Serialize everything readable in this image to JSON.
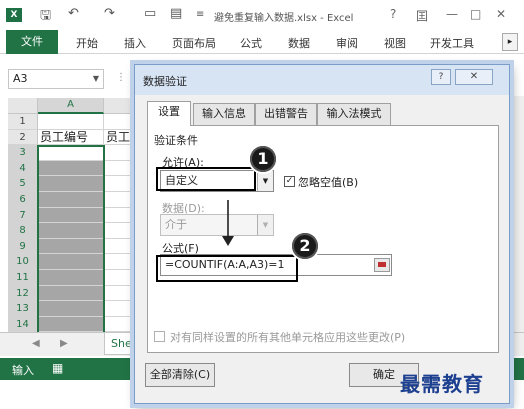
{
  "excel": {
    "logo": "X",
    "quick_access": {
      "save_icon": "save-icon",
      "undo_icon": "undo-icon",
      "redo_icon": "redo-icon"
    },
    "title_prefix": "≡",
    "title": "避免重复输入数据.xlsx - Excel",
    "window_controls": [
      "?",
      "囯",
      "—",
      "□",
      "✕"
    ],
    "file_tab": "文件",
    "ribbon_tabs": [
      "开始",
      "插入",
      "页面布局",
      "公式",
      "数据",
      "审阅",
      "视图",
      "开发工具"
    ],
    "ribbon_scroll": "▸",
    "namebox": "A3",
    "namebox_arrow": "▼",
    "formula_dots": "⋮",
    "column_header": "A",
    "rows": [
      {
        "num": "1",
        "a": "",
        "b": ""
      },
      {
        "num": "2",
        "a": "员工编号",
        "b": "员工"
      },
      {
        "num": "3",
        "a": "",
        "b": ""
      },
      {
        "num": "4",
        "a": "",
        "b": ""
      },
      {
        "num": "5",
        "a": "",
        "b": ""
      },
      {
        "num": "6",
        "a": "",
        "b": ""
      },
      {
        "num": "7",
        "a": "",
        "b": ""
      },
      {
        "num": "8",
        "a": "",
        "b": ""
      },
      {
        "num": "9",
        "a": "",
        "b": ""
      },
      {
        "num": "10",
        "a": "",
        "b": ""
      },
      {
        "num": "11",
        "a": "",
        "b": ""
      },
      {
        "num": "12",
        "a": "",
        "b": ""
      },
      {
        "num": "13",
        "a": "",
        "b": ""
      },
      {
        "num": "14",
        "a": "",
        "b": ""
      }
    ],
    "sheet_tab": "She",
    "sheet_nav": [
      "◀",
      "▶"
    ],
    "status": "输入",
    "status_icon": "▦"
  },
  "dialog": {
    "title": "数据验证",
    "help_btn": "?",
    "close_btn": "✕",
    "tabs": [
      "设置",
      "输入信息",
      "出错警告",
      "输入法模式"
    ],
    "criteria_heading": "验证条件",
    "allow_label": "允许(A):",
    "allow_value": "自定义",
    "ignore_blank_label": "忽略空值(B)",
    "ignore_blank_checked": "✓",
    "data_label": "数据(D):",
    "data_value": "介于",
    "formula_label": "公式(F)",
    "formula_value": "=COUNTIF(A:A,A3)=1",
    "apply_all_label": "对有同样设置的所有其他单元格应用这些更改(P)",
    "clear_all": "全部清除(C)",
    "ok": "确定",
    "dropdown_arrow": "▼"
  },
  "annotations": {
    "badge1": "1",
    "badge2": "2",
    "watermark": "最需教育"
  }
}
